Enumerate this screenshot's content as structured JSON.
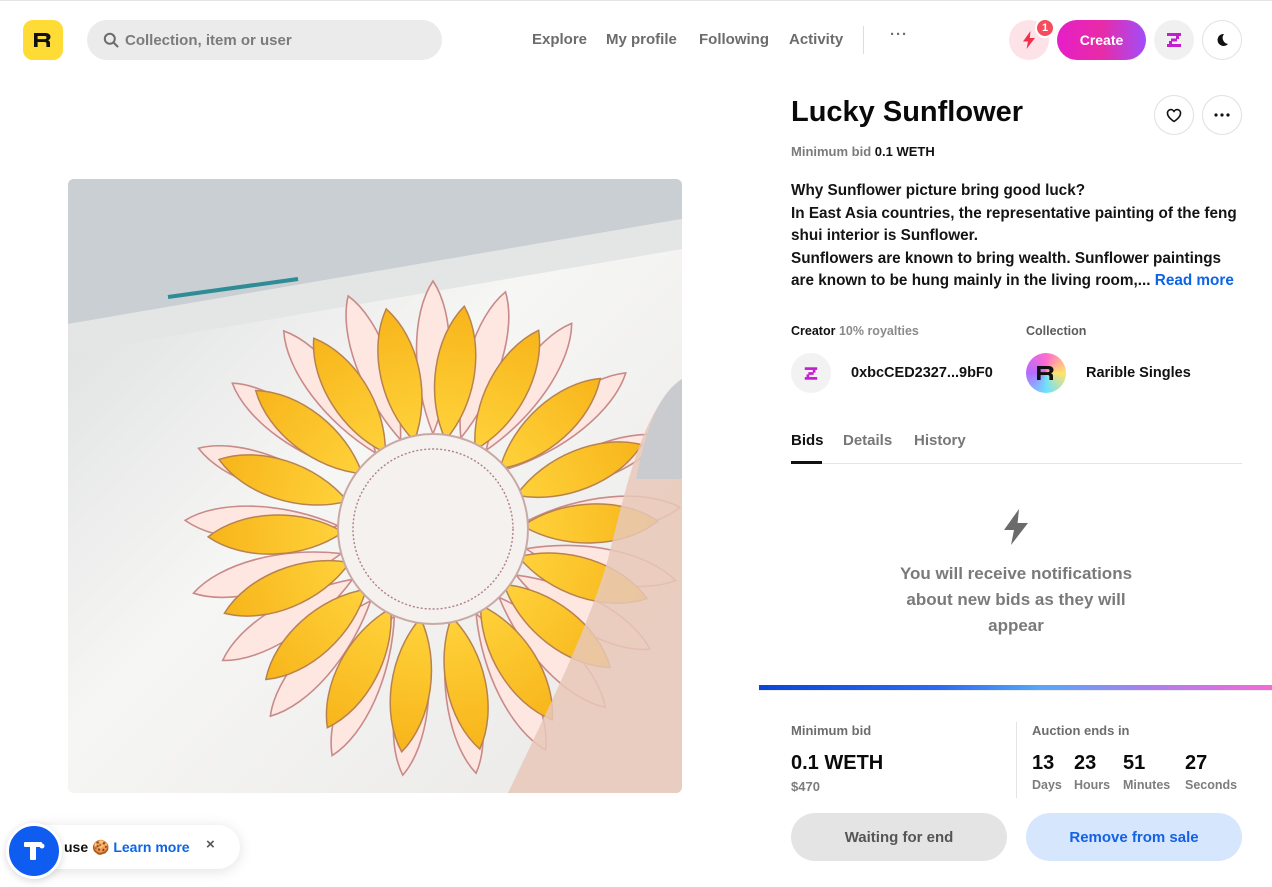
{
  "header": {
    "search_placeholder": "Collection, item or user",
    "nav": [
      "Explore",
      "My profile",
      "Following",
      "Activity"
    ],
    "more": "···",
    "notification_count": "1",
    "create_label": "Create"
  },
  "item": {
    "title": "Lucky Sunflower",
    "min_bid_label": "Minimum bid",
    "min_bid_value": "0.1 WETH",
    "description_lines": [
      "Why Sunflower picture bring good luck?",
      "In East Asia countries, the representative painting of the feng",
      "shui interior is Sunflower.",
      "Sunflowers are known to bring wealth. Sunflower paintings",
      "are known to be hung mainly in the living room,..."
    ],
    "read_more": "Read more",
    "creator_label": "Creator",
    "royalties": "10% royalties",
    "creator_address": "0xbcCED2327...9bF0",
    "collection_label": "Collection",
    "collection_name": "Rarible Singles"
  },
  "tabs": [
    "Bids",
    "Details",
    "History"
  ],
  "empty_state": {
    "lines": [
      "You will receive notifications",
      "about new bids as they will",
      "appear"
    ]
  },
  "auction": {
    "min_bid_label": "Minimum bid",
    "min_bid_value": "0.1 WETH",
    "usd_value": "$470",
    "ends_label": "Auction ends in",
    "countdown": [
      {
        "value": "13",
        "unit": "Days"
      },
      {
        "value": "23",
        "unit": "Hours"
      },
      {
        "value": "51",
        "unit": "Minutes"
      },
      {
        "value": "27",
        "unit": "Seconds"
      }
    ],
    "wait_label": "Waiting for end",
    "remove_label": "Remove from sale"
  },
  "cookie": {
    "text": "use 🍪",
    "learn_more": "Learn more",
    "close": "×"
  },
  "colors": {
    "logo_yellow": "#fedb35",
    "accent_blue": "#0d64e6",
    "create_pink": "#e61ec8",
    "wallet_purple": "#c21ed0"
  }
}
